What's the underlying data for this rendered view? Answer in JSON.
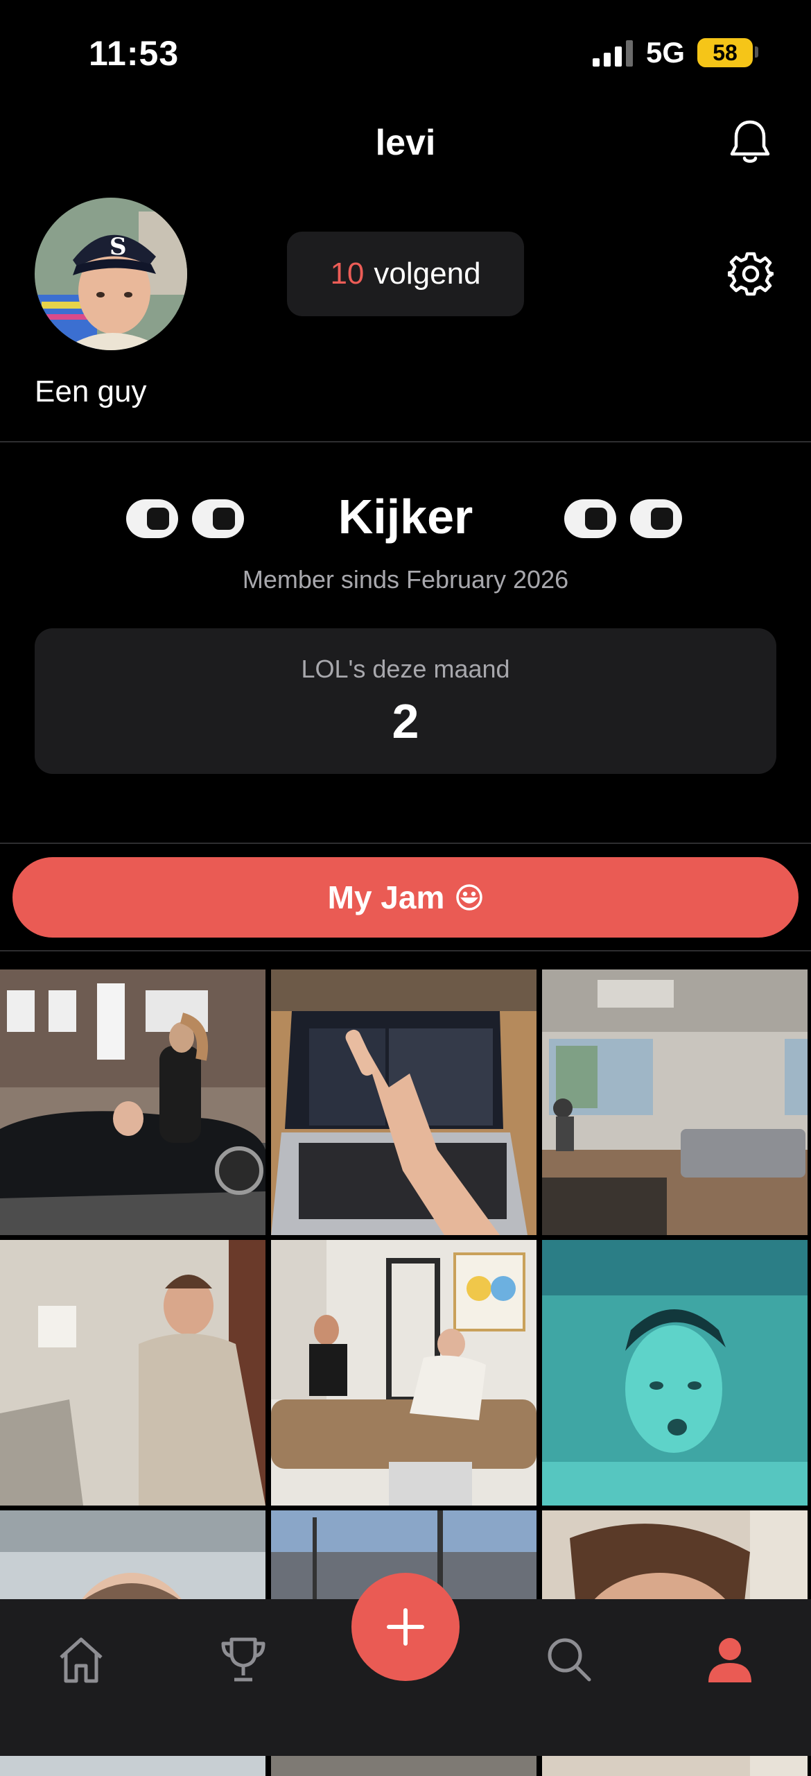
{
  "status": {
    "time": "11:53",
    "network": "5G",
    "battery": "58"
  },
  "header": {
    "title": "levi",
    "bell_icon": "bell-icon"
  },
  "profile": {
    "following_count": "10",
    "following_label": "volgend",
    "display_name": "Een guy",
    "settings_icon": "gear-icon"
  },
  "level": {
    "name": "Kijker",
    "member_since": "Member sinds February 2026",
    "lol_label": "LOL's deze maand",
    "lol_count": "2"
  },
  "jam": {
    "label": "My Jam",
    "icon": "smile-icon"
  },
  "colors": {
    "accent": "#ea5b54",
    "card": "#1c1c1e",
    "background": "#000000",
    "battery": "#f5c518"
  },
  "tabs": [
    "home-icon",
    "trophy-icon",
    "plus-icon",
    "search-icon",
    "profile-icon"
  ]
}
